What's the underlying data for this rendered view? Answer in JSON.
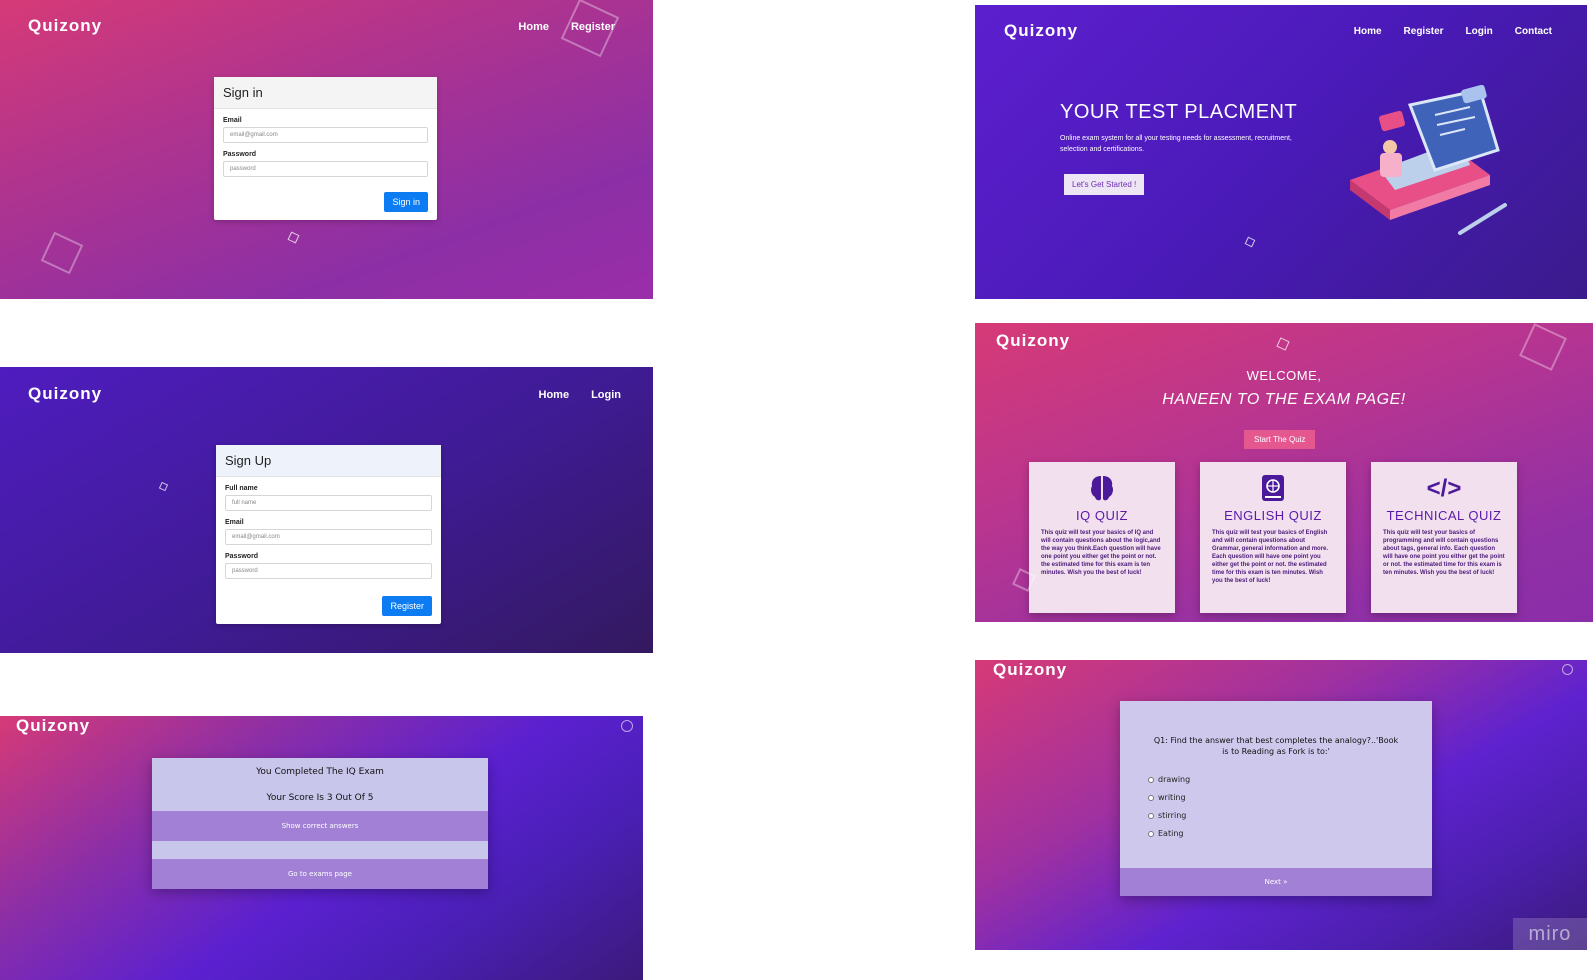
{
  "brand": "Quizony",
  "signin": {
    "nav": [
      "Home",
      "Register"
    ],
    "card_title": "Sign in",
    "email_label": "Email",
    "email_placeholder": "email@gmail.com",
    "password_label": "Password",
    "password_placeholder": "password",
    "button": "Sign in"
  },
  "landing": {
    "nav": [
      "Home",
      "Register",
      "Login",
      "Contact"
    ],
    "headline": "YOUR TEST PLACMENT",
    "subtext": "Online exam system for all your testing needs for assessment, recruitment, selection and certifications.",
    "cta": "Let's Get Started !"
  },
  "signup": {
    "nav": [
      "Home",
      "Login"
    ],
    "card_title": "Sign Up",
    "name_label": "Full name",
    "name_placeholder": "full name",
    "email_label": "Email",
    "email_placeholder": "email@gmail.com",
    "password_label": "Password",
    "password_placeholder": "password",
    "button": "Register"
  },
  "exam": {
    "welcome": "WELCOME,",
    "subtitle": "HANEEN TO THE EXAM PAGE!",
    "start_button": "Start The Quiz",
    "quizzes": [
      {
        "icon": "brain-icon",
        "title": "IQ QUIZ",
        "desc": "This quiz will test your basics of IQ and will contain questions about the logic,and the way you think.Each question will have one point you either get the point or not. the estimated time for this exam is ten minutes. Wish you the best of luck!"
      },
      {
        "icon": "book-icon",
        "title": "ENGLISH QUIZ",
        "desc": "This quiz will test your basics of English and will contain questions about Grammar, general information and more. Each question will have one point you either get the point or not. the estimated time for this exam is ten minutes. Wish you the best of luck!"
      },
      {
        "icon": "code-icon",
        "title": "TECHNICAL QUIZ",
        "desc": "This quiz will test your basics of programming and will contain questions about tags, general info. Each question will have one point you either get the point or not. the estimated time for this exam is ten minutes. Wish you the best of luck!"
      }
    ]
  },
  "result": {
    "completed": "You Completed The IQ Exam",
    "score": "Your Score Is 3 Out Of 5",
    "show_answers": "Show correct answers",
    "go_exams": "Go to exams page"
  },
  "question": {
    "text": "Q1: Find the answer that best completes the analogy?..'Book is to Reading as Fork is to:'",
    "options": [
      "drawing",
      "writing",
      "stirring",
      "Eating"
    ],
    "next": "Next »"
  },
  "watermark": "miro"
}
